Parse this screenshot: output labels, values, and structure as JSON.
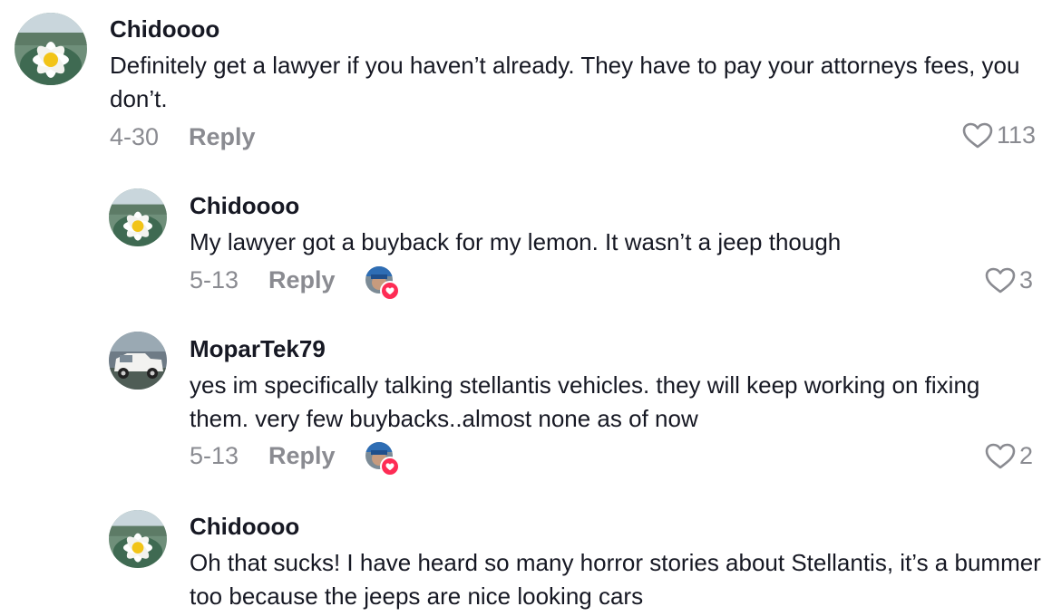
{
  "comments": [
    {
      "username": "Chidoooo",
      "text": "Definitely get a lawyer if you haven’t already. They have to pay your attorneys fees, you don’t.",
      "date": "4-30",
      "reply_label": "Reply",
      "likes": "113",
      "avatar": "water-lily-avatar"
    },
    {
      "username": "Chidoooo",
      "text": "My lawyer got a buyback for my lemon. It wasn’t a jeep though",
      "date": "5-13",
      "reply_label": "Reply",
      "likes": "3",
      "avatar": "water-lily-avatar",
      "liked_by_creator": true
    },
    {
      "username": "MoparTek79",
      "text": "yes im specifically talking stellantis vehicles. they will keep working on fixing them. very few buybacks..almost none as of now",
      "date": "5-13",
      "reply_label": "Reply",
      "likes": "2",
      "avatar": "white-truck-avatar",
      "liked_by_creator": true
    },
    {
      "username": "Chidoooo",
      "text": "Oh that sucks! I have heard so many horror stories about Stellantis, it’s a bummer too because the jeeps are nice looking cars",
      "avatar": "water-lily-avatar"
    }
  ],
  "colors": {
    "text": "#161823",
    "muted": "#8a8b91",
    "accent": "#fe2c55"
  }
}
